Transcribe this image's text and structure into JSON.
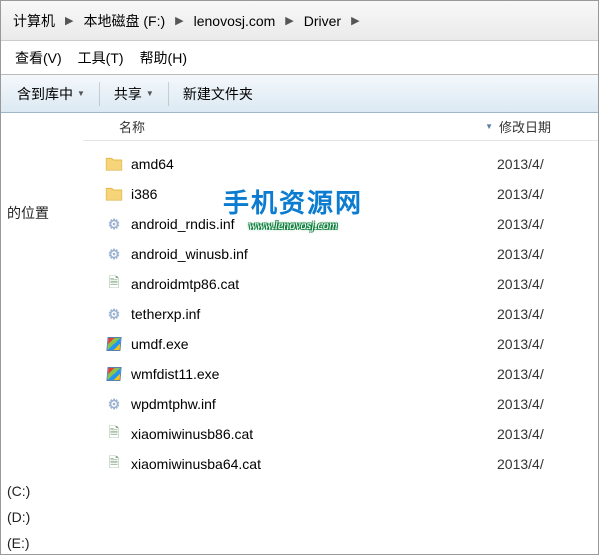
{
  "breadcrumb": {
    "items": [
      "计算机",
      "本地磁盘 (F:)",
      "lenovosj.com",
      "Driver"
    ]
  },
  "menubar": {
    "view": "查看(V)",
    "tools": "工具(T)",
    "help": "帮助(H)"
  },
  "toolbar": {
    "include": "含到库中",
    "share": "共享",
    "newfolder": "新建文件夹"
  },
  "sidebar": {
    "location": "的位置",
    "drives": [
      "(C:)",
      "(D:)",
      "(E:)"
    ]
  },
  "columns": {
    "name": "名称",
    "date": "修改日期"
  },
  "files": [
    {
      "name": "amd64",
      "date": "2013/4/",
      "type": "folder"
    },
    {
      "name": "i386",
      "date": "2013/4/",
      "type": "folder"
    },
    {
      "name": "android_rndis.inf",
      "date": "2013/4/",
      "type": "inf"
    },
    {
      "name": "android_winusb.inf",
      "date": "2013/4/",
      "type": "inf"
    },
    {
      "name": "androidmtp86.cat",
      "date": "2013/4/",
      "type": "cat"
    },
    {
      "name": "tetherxp.inf",
      "date": "2013/4/",
      "type": "inf"
    },
    {
      "name": "umdf.exe",
      "date": "2013/4/",
      "type": "exe"
    },
    {
      "name": "wmfdist11.exe",
      "date": "2013/4/",
      "type": "exe"
    },
    {
      "name": "wpdmtphw.inf",
      "date": "2013/4/",
      "type": "inf"
    },
    {
      "name": "xiaomiwinusb86.cat",
      "date": "2013/4/",
      "type": "cat"
    },
    {
      "name": "xiaomiwinusba64.cat",
      "date": "2013/4/",
      "type": "cat"
    }
  ],
  "watermark": {
    "zh": "手机资源网",
    "url": "www.lenovosj.com"
  }
}
